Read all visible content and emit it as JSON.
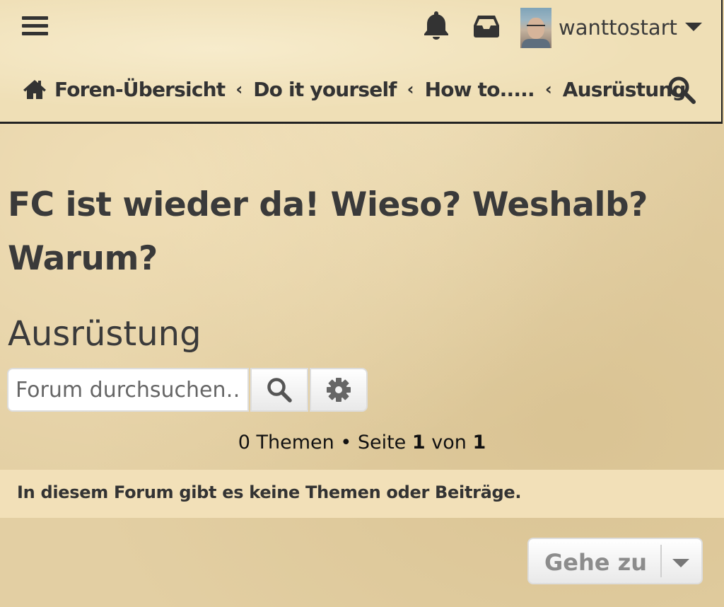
{
  "header": {
    "menu_icon": "hamburger-icon",
    "notifications_icon": "bell-icon",
    "inbox_icon": "inbox-icon",
    "username": "wanttostart"
  },
  "breadcrumb": {
    "home_icon": "home-icon",
    "items": [
      "Foren-Übersicht",
      "Do it yourself",
      "How to.....",
      "Ausrüstung"
    ],
    "separator": "‹"
  },
  "topic_title": "FC ist wieder da! Wieso? Weshalb? Warum?",
  "forum_name": "Ausrüstung",
  "search": {
    "placeholder": "Forum durchsuchen…"
  },
  "pagination": {
    "topics_text": "0 Themen",
    "bullet": " • ",
    "page_label": "Seite",
    "current_page": "1",
    "of_label": "von",
    "total_pages": "1"
  },
  "notice": "In diesem Forum gibt es keine Themen oder Beiträge.",
  "jumpbox": {
    "label": "Gehe zu"
  }
}
